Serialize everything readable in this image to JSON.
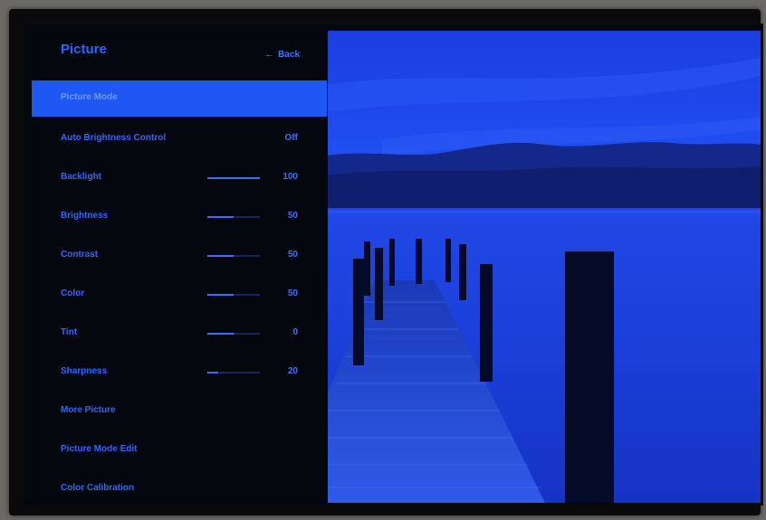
{
  "menu": {
    "title": "Picture",
    "back_label": "Back",
    "highlighted_item": "Picture Mode",
    "items": [
      {
        "label": "Auto Brightness Control",
        "value": "Off"
      },
      {
        "label": "Backlight",
        "value": "100",
        "level": 1.0
      },
      {
        "label": "Brightness",
        "value": "50",
        "level": 0.5
      },
      {
        "label": "Contrast",
        "value": "50",
        "level": 0.5
      },
      {
        "label": "Color",
        "value": "50",
        "level": 0.5
      },
      {
        "label": "Tint",
        "value": "0",
        "level": 0.5
      },
      {
        "label": "Sharpness",
        "value": "20",
        "level": 0.2
      },
      {
        "label": "More Picture"
      },
      {
        "label": "Picture Mode Edit"
      },
      {
        "label": "Color Calibration"
      }
    ]
  },
  "colors": {
    "accent": "#1f57f2",
    "menu_bg": "#04060e",
    "text": "#2f66ff"
  },
  "icons": {
    "back": "arrow-left-icon"
  }
}
